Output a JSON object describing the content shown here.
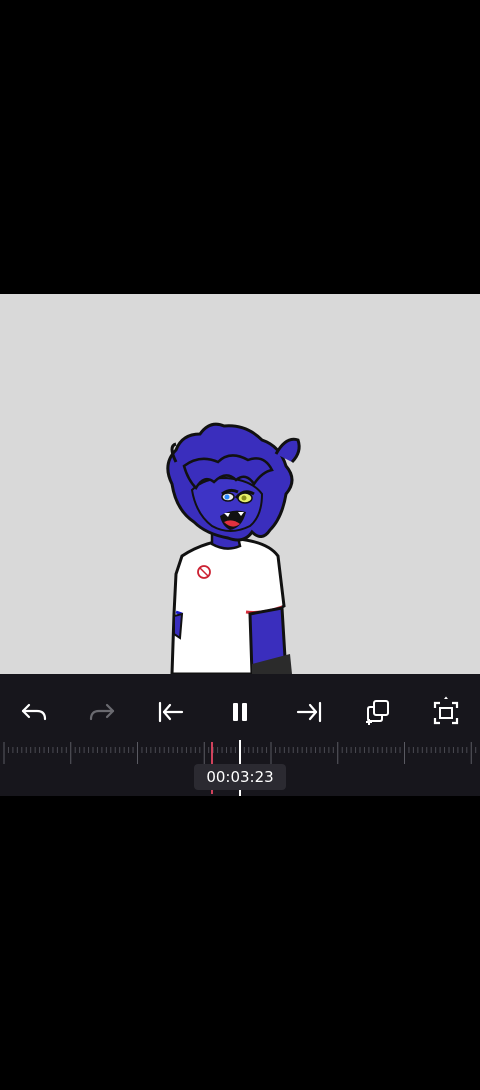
{
  "player": {
    "current_time": "00:03:23",
    "state": "playing"
  },
  "toolbar": {
    "items": [
      {
        "name": "undo-icon",
        "enabled": true
      },
      {
        "name": "redo-icon",
        "enabled": false
      },
      {
        "name": "skip-to-start-icon",
        "enabled": true
      },
      {
        "name": "pause-icon",
        "enabled": true
      },
      {
        "name": "skip-to-end-icon",
        "enabled": true
      },
      {
        "name": "copy-frame-icon",
        "enabled": true
      },
      {
        "name": "fullscreen-icon",
        "enabled": true
      }
    ]
  },
  "colors": {
    "canvas_background": "#d9d9d9",
    "toolbar_background": "#17161c",
    "icon_color": "#ffffff",
    "disabled_icon_color": "#6a6a70",
    "marker_color": "#ff4d6d"
  }
}
